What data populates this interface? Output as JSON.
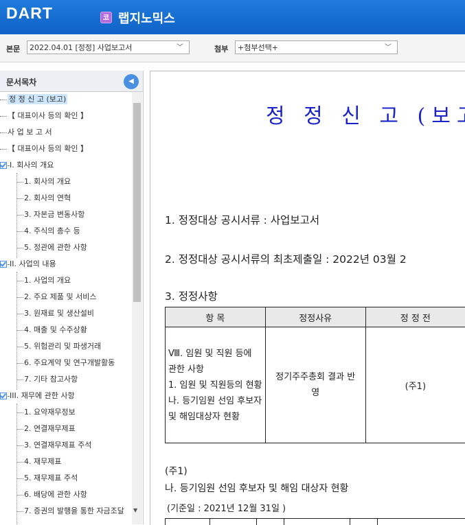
{
  "header": {
    "logo": "DART",
    "company_badge": "코",
    "company_name": "랩지노믹스"
  },
  "selectors": {
    "body_label": "본문",
    "body_value": "2022.04.01 [정정] 사업보고서",
    "attach_label": "첨부",
    "attach_value": "+첨부선택+"
  },
  "toc": {
    "title": "문서목차",
    "items": [
      {
        "label": "정 정 신 고 (보고)"
      },
      {
        "label": "【 대표이사 등의 확인 】"
      },
      {
        "label": "사 업 보 고 서"
      },
      {
        "label": "【 대표이사 등의 확인 】"
      },
      {
        "label": "I. 회사의 개요"
      },
      {
        "label": "1. 회사의 개요"
      },
      {
        "label": "2. 회사의 연혁"
      },
      {
        "label": "3. 자본금 변동사항"
      },
      {
        "label": "4. 주식의 총수 등"
      },
      {
        "label": "5. 정관에 관한 사항"
      },
      {
        "label": "II. 사업의 내용"
      },
      {
        "label": "1. 사업의 개요"
      },
      {
        "label": "2. 주요 제품 및 서비스"
      },
      {
        "label": "3. 원재료 및 생산설비"
      },
      {
        "label": "4. 매출 및 수주상황"
      },
      {
        "label": "5. 위험관리 및 파생거래"
      },
      {
        "label": "6. 주요계약 및 연구개발활동"
      },
      {
        "label": "7. 기타 참고사항"
      },
      {
        "label": "III. 재무에 관한 사항"
      },
      {
        "label": "1. 요약재무정보"
      },
      {
        "label": "2. 연결재무제표"
      },
      {
        "label": "3. 연결재무제표 주석"
      },
      {
        "label": "4. 재무제표"
      },
      {
        "label": "5. 재무제표 주석"
      },
      {
        "label": "6. 배당에 관한 사항"
      },
      {
        "label": "7. 증권의 발행을 통한 자금조달"
      }
    ]
  },
  "doc": {
    "title": "정 정 신 고 (보고",
    "p1": "1. 정정대상 공시서류 : 사업보고서",
    "p2": "2. 정정대상 공시서류의 최초제출일 : 2022년 03월 2",
    "p3": "3. 정정사항",
    "table": {
      "headers": [
        "항 목",
        "정정사유",
        "정 정 전"
      ],
      "row_item": "Ⅷ. 임원 및 직원 등에 관한 사항\n1. 임원 및 직원등의 현황\n나. 등기임원 선임 후보자 및 해임대상자 현황",
      "row_reason": "정기주주총회 결과 반영",
      "row_before": "(주1)"
    },
    "note_label": "(주1)",
    "note_title": "나. 등기임원 선임 후보자 및 해임 대상자 현황",
    "base_date": "(기준일 :        2021년 12월 31일      )"
  }
}
